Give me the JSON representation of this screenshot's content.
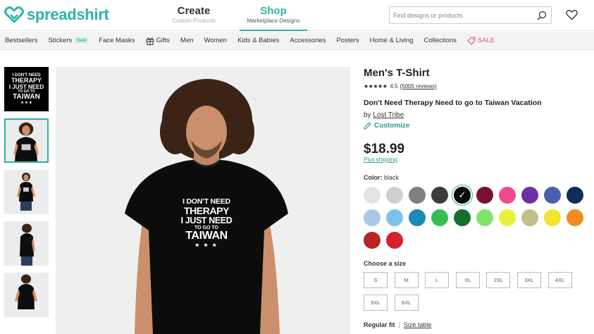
{
  "header": {
    "logo_text": "spreadshirt",
    "nav": [
      {
        "title": "Create",
        "subtitle": "Custom Products"
      },
      {
        "title": "Shop",
        "subtitle": "Marketplace Designs"
      }
    ],
    "search_placeholder": "Find designs or products",
    "accent_color": "#2db3a6"
  },
  "categories": [
    {
      "label": "Bestsellers"
    },
    {
      "label": "Stickers",
      "badge": "New"
    },
    {
      "label": "Face Masks"
    },
    {
      "label": "Gifts",
      "icon": "gift-icon"
    },
    {
      "label": "Men"
    },
    {
      "label": "Women"
    },
    {
      "label": "Kids & Babies"
    },
    {
      "label": "Accessories"
    },
    {
      "label": "Posters"
    },
    {
      "label": "Home & Living"
    },
    {
      "label": "Collections"
    },
    {
      "label": "SALE",
      "icon": "tag-icon"
    }
  ],
  "print_design": {
    "line1": "I DON'T NEED",
    "line2": "THERAPY",
    "line3": "I JUST NEED",
    "line4": "TO GO TO",
    "line5": "TAIWAN",
    "stars": "★ ★ ★"
  },
  "product": {
    "type": "Men's T-Shirt",
    "rating_stars": "★★★★★",
    "rating_value": "4.5",
    "reviews": "(5005 reviews)",
    "title": "Don't Need Therapy Need to go to Taiwan Vacation",
    "by_label": "by",
    "designer": "Lost Tribe",
    "customize_label": "Customize",
    "price": "$18.99",
    "shipping_label": "Plus shipping",
    "color_label": "Color:",
    "color_value": "black",
    "colors": [
      "#e4e4e4",
      "#cfcfcf",
      "#808080",
      "#3c3c3c",
      "#0a0a0a",
      "#7b0f33",
      "#f04a8e",
      "#6d2fa6",
      "#4b60ad",
      "#0d2d5a",
      "#a9c8e6",
      "#7cc3ec",
      "#1c88b4",
      "#36bf51",
      "#15702c",
      "#7ee36d",
      "#e8f03a",
      "#c3bf8a",
      "#f1e42c",
      "#f28b22",
      "#b8232a",
      "#d9202c"
    ],
    "selected_color_index": 4,
    "size_label": "Choose a size",
    "sizes": [
      "S",
      "M",
      "L",
      "XL",
      "2XL",
      "3XL",
      "4XL",
      "5XL",
      "6XL"
    ],
    "fit_label": "Regular fit",
    "size_table_label": "Size table"
  }
}
